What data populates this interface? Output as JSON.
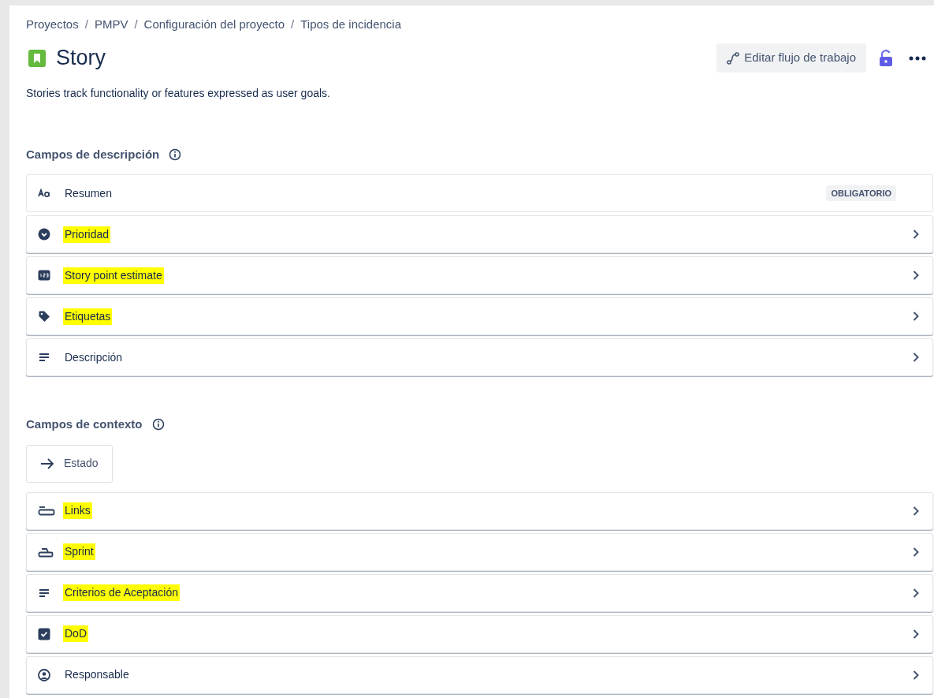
{
  "breadcrumbs": [
    {
      "kind": "link",
      "text": "Proyectos"
    },
    {
      "kind": "separator",
      "text": "/"
    },
    {
      "kind": "link",
      "text": "PMPV"
    },
    {
      "kind": "separator",
      "text": "/"
    },
    {
      "kind": "link",
      "text": "Configuración del proyecto"
    },
    {
      "kind": "separator",
      "text": "/"
    },
    {
      "kind": "link",
      "text": "Tipos de incidencia"
    }
  ],
  "title": "Story",
  "actions": {
    "edit_workflow": "Editar flujo de trabajo"
  },
  "description": "Stories track functionality or features expressed as user goals.",
  "sections": [
    {
      "heading": "Campos de descripción",
      "fields": [
        {
          "kind": "text",
          "label": "Resumen",
          "highlighted": false,
          "badge": "OBLIGATORIO",
          "expandable": false
        },
        {
          "kind": "priority",
          "label": "Prioridad",
          "highlighted": true,
          "expandable": true
        },
        {
          "kind": "number",
          "label": "Story point estimate",
          "highlighted": true,
          "expandable": true
        },
        {
          "kind": "tag",
          "label": "Etiquetas",
          "highlighted": true,
          "expandable": true
        },
        {
          "kind": "lines",
          "label": "Descripción",
          "highlighted": false,
          "expandable": true
        }
      ]
    },
    {
      "heading": "Campos de contexto",
      "chip": {
        "label": "Estado"
      },
      "fields": [
        {
          "kind": "link",
          "label": "Links",
          "highlighted": true,
          "expandable": true
        },
        {
          "kind": "sprint",
          "label": "Sprint",
          "highlighted": true,
          "expandable": true
        },
        {
          "kind": "lines",
          "label": "Criterios de Aceptación",
          "highlighted": true,
          "expandable": true
        },
        {
          "kind": "check",
          "label": "DoD",
          "highlighted": true,
          "expandable": true
        },
        {
          "kind": "person",
          "label": "Responsable",
          "highlighted": false,
          "expandable": true
        }
      ]
    }
  ]
}
